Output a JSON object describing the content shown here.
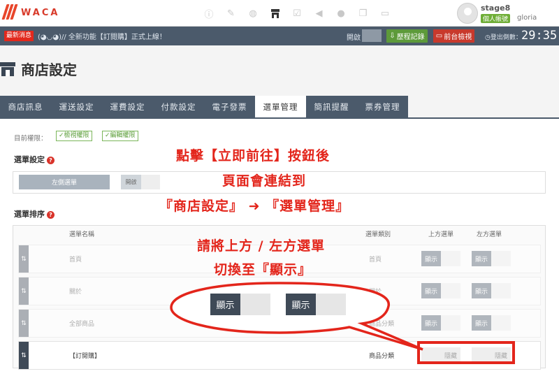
{
  "app": {
    "logo_text": "WACA"
  },
  "topbar": {
    "icons": [
      "info-icon",
      "edit-icon",
      "palette-icon",
      "store-icon",
      "clipboard-icon",
      "megaphone-icon",
      "user-icon",
      "copy-icon",
      "monitor-icon"
    ],
    "active_icon": "store-icon",
    "user_name": "stage8",
    "user_badge": "個人帳號",
    "user_sub": "gloria"
  },
  "statusbar": {
    "news_tag": "最新消息",
    "news_text": "(◕◡◕)// 全新功能【訂閱購】正式上線！",
    "open_label": "開啟",
    "history_button": "歷程記錄",
    "preview_button": "前台檢視",
    "logout_label": "登出倒數：",
    "timer": "29:35"
  },
  "page": {
    "title": "商店設定"
  },
  "tabs": [
    {
      "label": "商店訊息",
      "active": false
    },
    {
      "label": "運送設定",
      "active": false
    },
    {
      "label": "運費設定",
      "active": false
    },
    {
      "label": "付款設定",
      "active": false
    },
    {
      "label": "電子發票",
      "active": false
    },
    {
      "label": "選單管理",
      "active": true
    },
    {
      "label": "簡訊提醒",
      "active": false
    },
    {
      "label": "票券管理",
      "active": false
    }
  ],
  "permissions": {
    "label": "目前權限：",
    "view": "✓檢視權限",
    "edit": "✓編輯權限"
  },
  "menu_setting": {
    "title": "選單設定",
    "left_menu_label": "左側選單",
    "switch_label": "開啟"
  },
  "menu_sort": {
    "title": "選單排序",
    "headers": {
      "name": "選單名稱",
      "category": "選單類別",
      "top": "上方選單",
      "left": "左方選單"
    },
    "rows": [
      {
        "name": "首頁",
        "category": "首頁",
        "top": "顯示",
        "left": "顯示",
        "faded": true
      },
      {
        "name": "關於",
        "category": "關於",
        "top": "顯示",
        "left": "顯示",
        "faded": true
      },
      {
        "name": "全部商品",
        "category": "商品分類",
        "top": "顯示",
        "left": "顯示",
        "faded": true
      },
      {
        "name": "【訂閱購】",
        "category": "商品分類",
        "top": "隱藏",
        "left": "隱藏",
        "faded": false
      }
    ]
  },
  "annotations": {
    "line1": "點擊【立即前往】按鈕後",
    "line2": "頁面會連結到",
    "line3": "『商店設定』 ➜ 『選單管理』",
    "line4": "請將上方 / 左方選單",
    "line5": "切換至『顯示』",
    "bubble_switch_1": "顯示",
    "bubble_switch_2": "顯示"
  },
  "colors": {
    "accent": "#4b5a6b",
    "annotation_red": "#e3251b",
    "success": "#5d9a3a",
    "danger": "#c8392c"
  }
}
